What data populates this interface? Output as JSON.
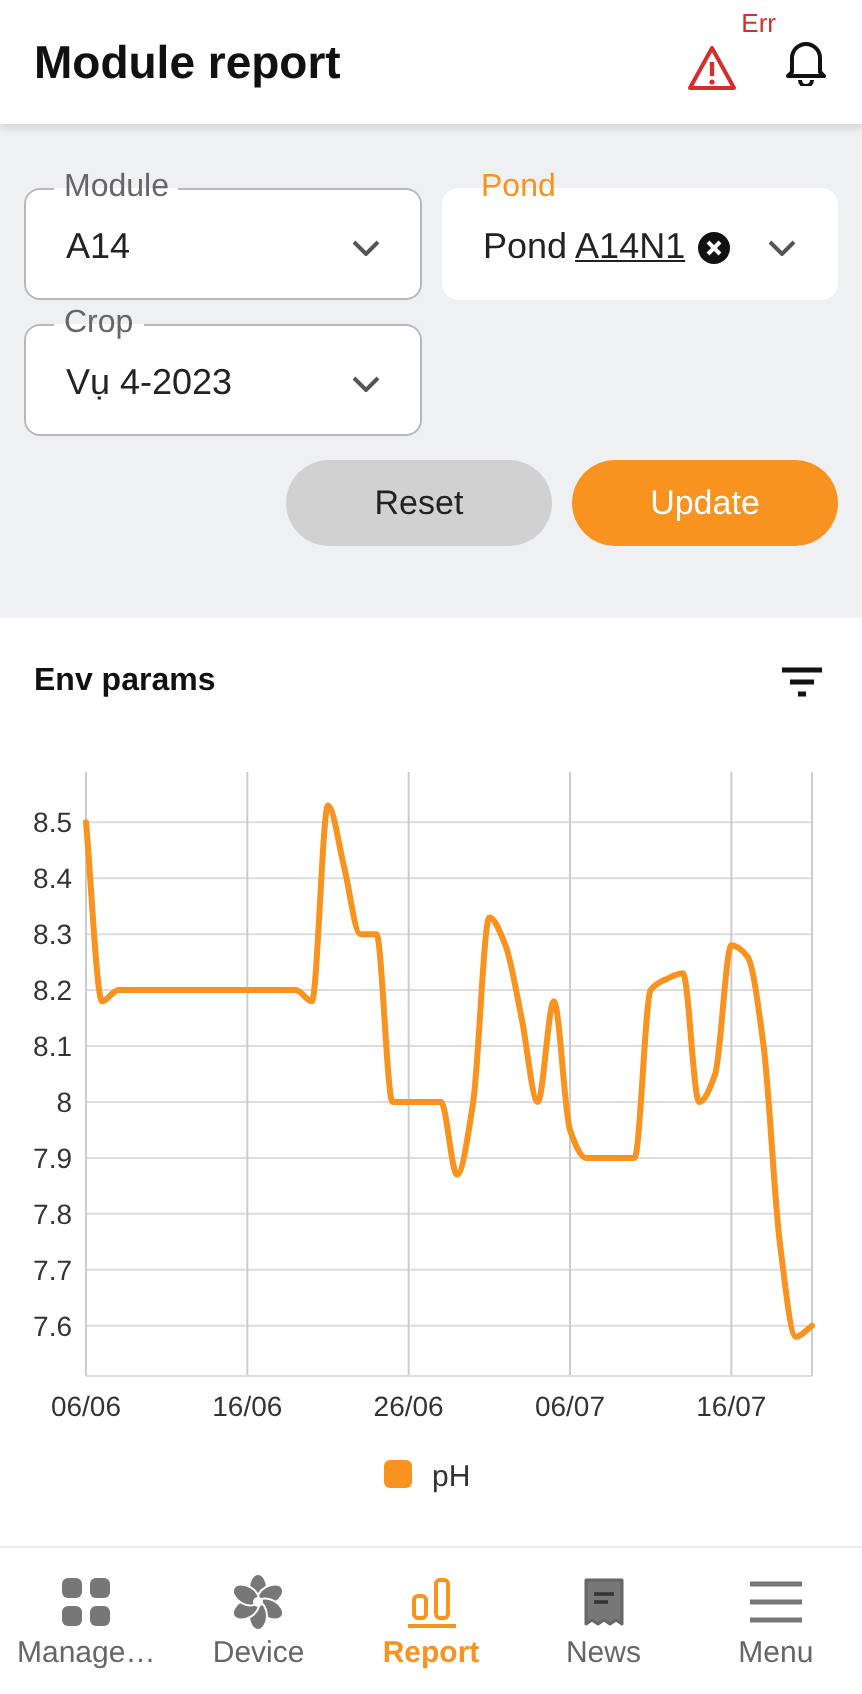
{
  "header": {
    "title": "Module report",
    "alert_badge": "Err"
  },
  "filters": [
    {
      "label": "Module",
      "value_plain": "A14",
      "focused": false,
      "clearable": false
    },
    {
      "label": "Pond",
      "value_plain": "Pond ",
      "value_underlined": "A14N1",
      "focused": true,
      "clearable": true
    },
    {
      "label": "Crop",
      "value_plain": "Vụ 4-2023",
      "focused": false,
      "clearable": false
    }
  ],
  "buttons": [
    {
      "label": "Reset",
      "kind": "secondary"
    },
    {
      "label": "Update",
      "kind": "primary"
    }
  ],
  "chart_card": {
    "title": "Env params",
    "chart_data": {
      "type": "line",
      "categories": [
        "06/06",
        null,
        null,
        null,
        null,
        null,
        null,
        null,
        null,
        null,
        "16/06",
        null,
        null,
        null,
        null,
        null,
        null,
        null,
        null,
        null,
        "26/06",
        null,
        null,
        null,
        null,
        null,
        null,
        null,
        null,
        null,
        "06/07",
        null,
        null,
        null,
        null,
        null,
        null,
        null,
        null,
        null,
        "16/07",
        null,
        null,
        null,
        null,
        null
      ],
      "series": [
        {
          "name": "pH",
          "color": "#f7931e",
          "values": [
            8.5,
            8.18,
            8.2,
            8.2,
            8.2,
            8.2,
            8.2,
            8.2,
            8.2,
            8.2,
            8.2,
            8.2,
            8.2,
            8.2,
            8.18,
            8.53,
            8.42,
            8.3,
            8.3,
            8.0,
            8.0,
            8.0,
            8.0,
            7.87,
            8.0,
            8.33,
            8.28,
            8.15,
            8.0,
            8.18,
            7.95,
            7.9,
            7.9,
            7.9,
            7.9,
            8.2,
            8.22,
            8.23,
            8.0,
            8.05,
            8.28,
            8.26,
            8.1,
            7.75,
            7.58,
            7.6
          ]
        }
      ],
      "ylim": [
        7.51,
        8.59
      ],
      "grid": true,
      "yticks": [
        7.6,
        7.7,
        7.8,
        7.9,
        {
          "value": 8,
          "label": "8"
        },
        8.1,
        8.2,
        8.3,
        8.4,
        8.5
      ]
    }
  },
  "nav": [
    {
      "label": "Manage…",
      "kind": "grid",
      "selected": false
    },
    {
      "label": "Device",
      "kind": "fan",
      "selected": false
    },
    {
      "label": "Report",
      "kind": "bars",
      "selected": true
    },
    {
      "label": "News",
      "kind": "news",
      "selected": false
    },
    {
      "label": "Menu",
      "kind": "menu",
      "selected": false
    }
  ]
}
